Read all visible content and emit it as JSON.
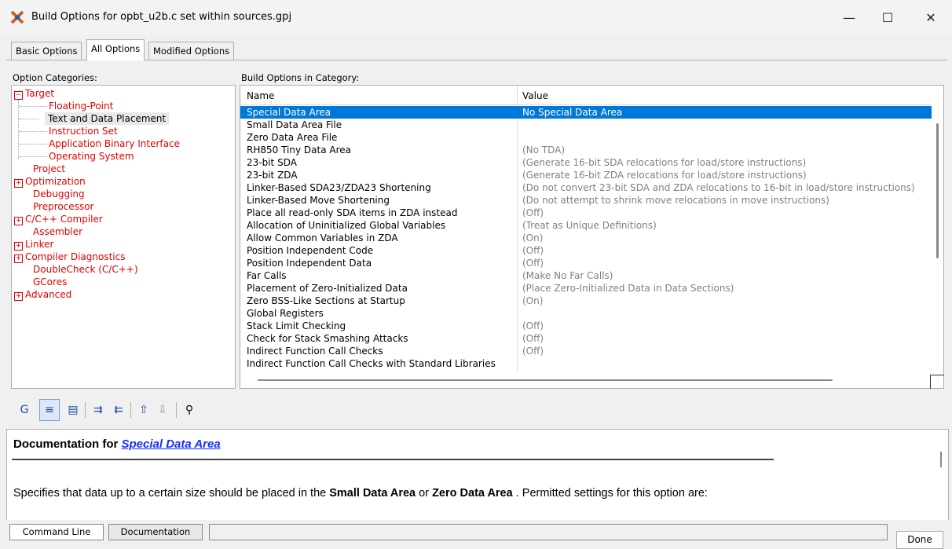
{
  "window": {
    "title": "Build Options for opbt_u2b.c set within sources.gpj",
    "minimize_glyph": "—",
    "maximize_glyph": "☐",
    "close_glyph": "✕"
  },
  "tabs": [
    "Basic Options",
    "All Options",
    "Modified Options"
  ],
  "labels": {
    "categories": "Option Categories:",
    "build_options": "Build Options in Category:"
  },
  "tree": {
    "target": "Target",
    "floating_point": "Floating-Point",
    "text_data": "Text and Data Placement",
    "instruction_set": "Instruction Set",
    "abi": "Application Binary Interface",
    "os": "Operating System",
    "project": "Project",
    "optimization": "Optimization",
    "debugging": "Debugging",
    "preprocessor": "Preprocessor",
    "compiler": "C/C++ Compiler",
    "assembler": "Assembler",
    "linker": "Linker",
    "diagnostics": "Compiler Diagnostics",
    "doublecheck": "DoubleCheck (C/C++)",
    "gcores": "GCores",
    "advanced": "Advanced",
    "expanded_glyph": "−",
    "collapsed_glyph": "+"
  },
  "options": {
    "name_header": "Name",
    "value_header": "Value",
    "rows": [
      {
        "name": "Special Data Area",
        "value": "No Special Data Area"
      },
      {
        "name": "Small Data Area File",
        "value": ""
      },
      {
        "name": "Zero Data Area File",
        "value": ""
      },
      {
        "name": "RH850 Tiny Data Area",
        "value": "(No TDA)"
      },
      {
        "name": "23-bit SDA",
        "value": "(Generate 16-bit SDA relocations for load/store instructions)"
      },
      {
        "name": "23-bit ZDA",
        "value": "(Generate 16-bit ZDA relocations for load/store instructions)"
      },
      {
        "name": "Linker-Based SDA23/ZDA23 Shortening",
        "value": "(Do not convert 23-bit SDA and ZDA relocations to 16-bit in load/store instructions)"
      },
      {
        "name": "Linker-Based Move Shortening",
        "value": "(Do not attempt to shrink move relocations in move instructions)"
      },
      {
        "name": "Place all read-only SDA items in ZDA instead",
        "value": "(Off)"
      },
      {
        "name": "Allocation of Uninitialized Global Variables",
        "value": "(Treat as Unique Definitions)"
      },
      {
        "name": "Allow Common Variables in ZDA",
        "value": "(On)"
      },
      {
        "name": "Position Independent Code",
        "value": "(Off)"
      },
      {
        "name": "Position Independent Data",
        "value": "(Off)"
      },
      {
        "name": "Far Calls",
        "value": "(Make No Far Calls)"
      },
      {
        "name": "Placement of Zero-Initialized Data",
        "value": "(Place Zero-Initialized Data in Data Sections)"
      },
      {
        "name": "Zero BSS-Like Sections at Startup",
        "value": "(On)"
      },
      {
        "name": "Global Registers",
        "value": ""
      },
      {
        "name": "Stack Limit Checking",
        "value": "(Off)"
      },
      {
        "name": "Check for Stack Smashing Attacks",
        "value": "(Off)"
      },
      {
        "name": "Indirect Function Call Checks",
        "value": "(Off)"
      },
      {
        "name": "Indirect Function Call Checks with Standard Libraries",
        "value": ""
      }
    ]
  },
  "toolbar": {
    "glyphs": [
      "G",
      "≡",
      "▤",
      "⇉",
      "⇇",
      "⇧",
      "⇩",
      "⚲"
    ]
  },
  "documentation": {
    "prefix": "Documentation for ",
    "link": "Special Data Area",
    "text1": "Specifies that data up to a certain size should be placed in the ",
    "bold1": "Small Data Area",
    "or": " or ",
    "bold2": "Zero Data Area",
    "text2": " . Permitted settings for this option are:"
  },
  "bottom": {
    "command_line": "Command Line",
    "documentation": "Documentation",
    "done": "Done"
  }
}
